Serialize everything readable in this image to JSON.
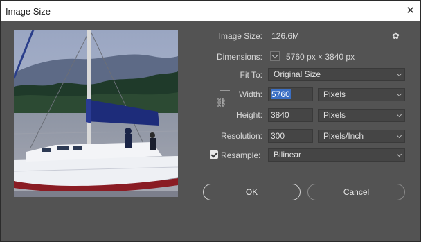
{
  "window": {
    "title": "Image Size"
  },
  "info": {
    "image_size_label": "Image Size:",
    "image_size_value": "126.6M",
    "dimensions_label": "Dimensions:",
    "dimensions_value": "5760 px  ×  3840 px"
  },
  "fit_to": {
    "label": "Fit To:",
    "value": "Original Size"
  },
  "width": {
    "label": "Width:",
    "value": "5760",
    "unit": "Pixels"
  },
  "height": {
    "label": "Height:",
    "value": "3840",
    "unit": "Pixels"
  },
  "resolution": {
    "label": "Resolution:",
    "value": "300",
    "unit": "Pixels/Inch"
  },
  "resample": {
    "label": "Resample:",
    "checked": true,
    "value": "Bilinear"
  },
  "buttons": {
    "ok": "OK",
    "cancel": "Cancel"
  },
  "icons": {
    "gear": "gear-icon",
    "link": "chain-link-icon",
    "close": "close-icon"
  },
  "colors": {
    "dialog_bg": "#535353",
    "field_bg": "#454545",
    "selection": "#3b6fc4",
    "text": "#d6d6d6"
  }
}
